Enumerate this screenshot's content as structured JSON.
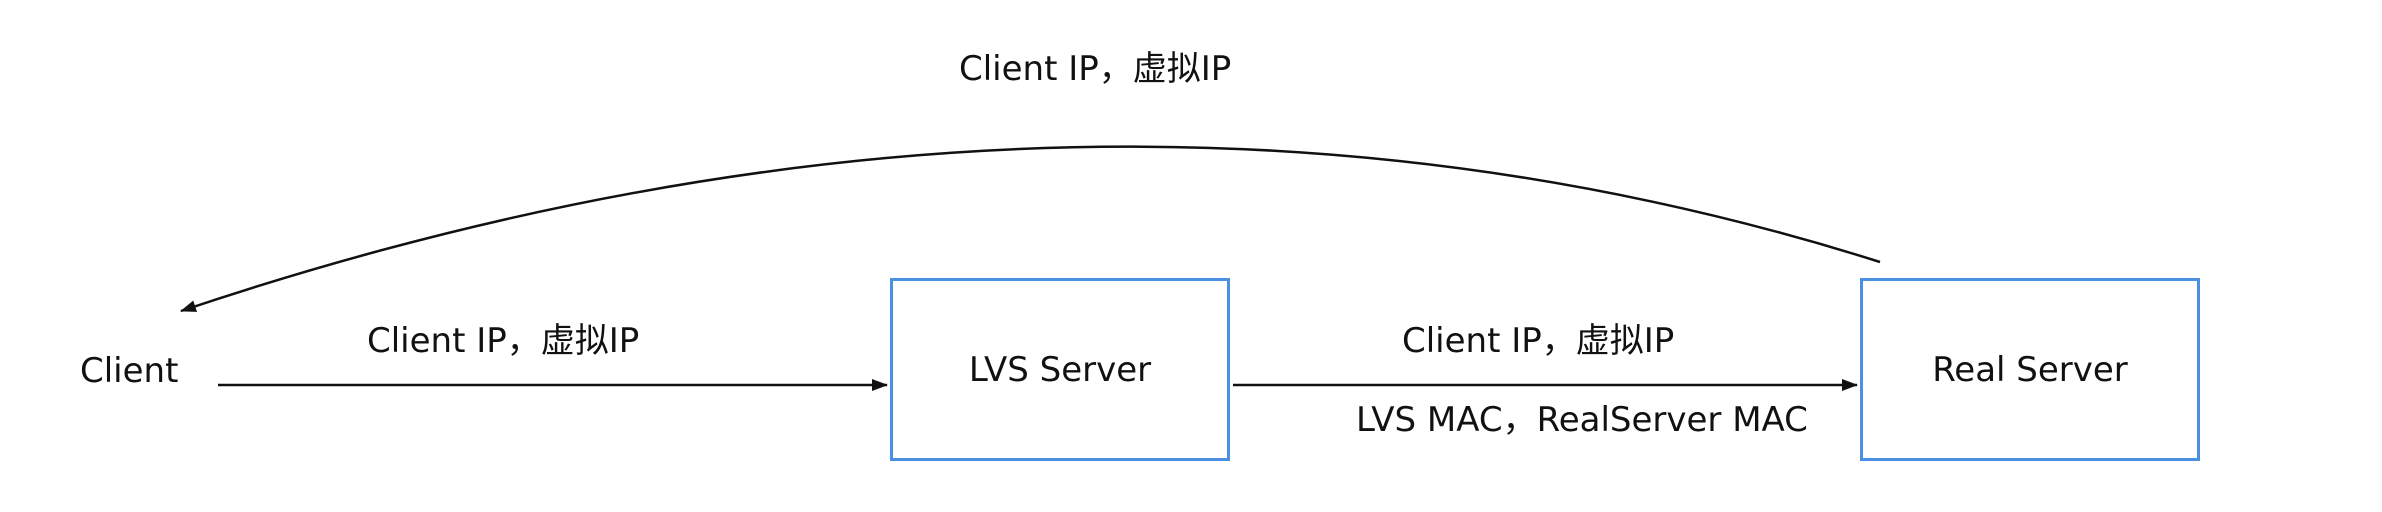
{
  "diagram": {
    "nodes": {
      "client": "Client",
      "lvs_server": "LVS Server",
      "real_server": "Real Server"
    },
    "edges": {
      "client_to_lvs": {
        "label": "Client IP，虚拟IP"
      },
      "lvs_to_real": {
        "label_top": "Client IP，虚拟IP",
        "label_bottom": "LVS MAC，RealServer MAC"
      },
      "real_to_client": {
        "label": "Client IP，虚拟IP"
      }
    },
    "colors": {
      "box_border": "#4a90e2",
      "line": "#111111",
      "text": "#111111",
      "background": "#ffffff"
    }
  }
}
